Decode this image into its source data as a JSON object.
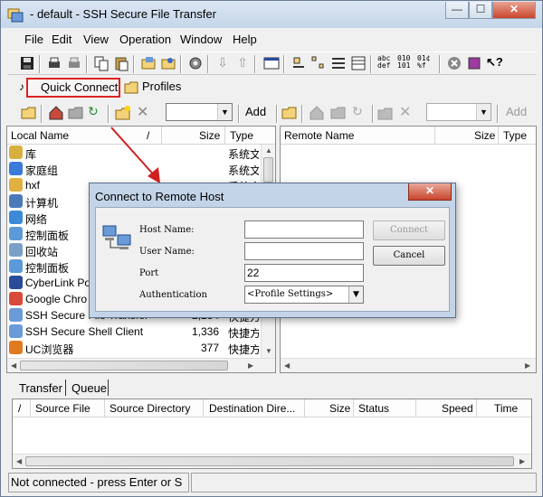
{
  "window": {
    "title": "- default - SSH Secure File Transfer",
    "minimize": "—",
    "maximize": "☐",
    "close": "✕"
  },
  "menu": [
    "File",
    "Edit",
    "View",
    "Operation",
    "Window",
    "Help"
  ],
  "toolbar": {
    "text_icons": [
      "abc\ndef",
      "010\n101",
      "01¢\n%f"
    ]
  },
  "tabs": {
    "quick_connect": "Quick Connect",
    "profiles": "Profiles"
  },
  "local_toolbar": {
    "add_label": "Add"
  },
  "remote_toolbar": {
    "add_label": "Add"
  },
  "local_pane": {
    "headers": {
      "name": "Local Name",
      "sort": "/",
      "size": "Size",
      "type": "Type"
    },
    "rows": [
      {
        "name": "库",
        "size": "",
        "type": "系统文",
        "icon": "library-icon"
      },
      {
        "name": "家庭组",
        "size": "",
        "type": "系统文",
        "icon": "homegroup-icon"
      },
      {
        "name": "hxf",
        "size": "",
        "type": "系统文",
        "icon": "user-folder-icon"
      },
      {
        "name": "计算机",
        "size": "",
        "type": "",
        "icon": "computer-icon"
      },
      {
        "name": "网络",
        "size": "",
        "type": "",
        "icon": "network-icon"
      },
      {
        "name": "控制面板",
        "size": "",
        "type": "",
        "icon": "control-panel-icon"
      },
      {
        "name": "回收站",
        "size": "",
        "type": "",
        "icon": "recycle-bin-icon"
      },
      {
        "name": "控制面板",
        "size": "",
        "type": "",
        "icon": "control-panel-icon"
      },
      {
        "name": "CyberLink Po",
        "size": "",
        "type": "",
        "icon": "cyberlink-icon"
      },
      {
        "name": "Google Chro",
        "size": "",
        "type": "",
        "icon": "chrome-icon"
      },
      {
        "name": "SSH Secure File Transfer",
        "size": "2,234",
        "type": "快捷方",
        "icon": "ssh-ftp-icon"
      },
      {
        "name": "SSH Secure Shell Client",
        "size": "1,336",
        "type": "快捷方",
        "icon": "ssh-shell-icon"
      },
      {
        "name": "UC浏览器",
        "size": "377",
        "type": "快捷方",
        "icon": "uc-browser-icon"
      }
    ]
  },
  "remote_pane": {
    "headers": {
      "name": "Remote Name",
      "size": "Size",
      "type": "Type"
    }
  },
  "lower_tabs": {
    "transfer": "Transfer",
    "queue": "Queue"
  },
  "transfer_table": {
    "headers": {
      "sort": "/",
      "source_file": "Source File",
      "source_dir": "Source Directory",
      "dest_dir": "Destination Dire...",
      "size": "Size",
      "status": "Status",
      "speed": "Speed",
      "time": "Time"
    }
  },
  "status_bar": {
    "text": "Not connected - press Enter or S"
  },
  "dialog": {
    "title": "Connect to Remote Host",
    "close": "✕",
    "host_label": "Host Name:",
    "user_label": "User Name:",
    "port_label": "Port",
    "auth_label": "Authentication",
    "host_value": "",
    "user_value": "",
    "port_value": "22",
    "auth_value": "<Profile Settings>",
    "connect_button": "Connect",
    "cancel_button": "Cancel"
  },
  "colors": {
    "highlight_box": "#e02020",
    "arrow": "#d02020",
    "dialog_frame": "#c3d4e8"
  }
}
